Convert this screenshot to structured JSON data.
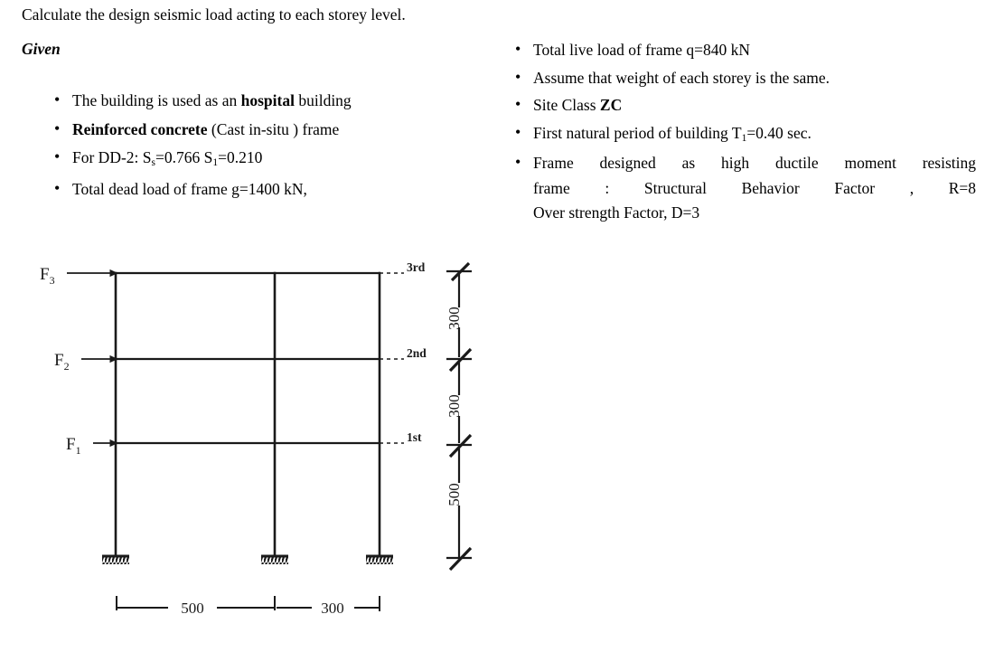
{
  "question": {
    "prompt": "Calculate the design seismic load acting to each storey level.",
    "given_heading": "Given"
  },
  "given_left": [
    {
      "segments": [
        {
          "text": "The building is used as an ",
          "bold": false
        },
        {
          "text": "hospital",
          "bold": true
        },
        {
          "text": " building",
          "bold": false
        }
      ]
    },
    {
      "segments": [
        {
          "text": "Reinforced concrete",
          "bold": true
        },
        {
          "text": " (Cast in-situ ) frame",
          "bold": false
        }
      ]
    },
    {
      "segments": [
        {
          "text": "For DD-2: S",
          "bold": false
        },
        {
          "text": "s",
          "sub": true
        },
        {
          "text": "=0.766  S",
          "bold": false
        },
        {
          "text": "1",
          "sub": true
        },
        {
          "text": "=0.210",
          "bold": false
        }
      ]
    },
    {
      "segments": [
        {
          "text": "Total dead load of frame  g=1400 kN,",
          "bold": false
        }
      ]
    }
  ],
  "given_right": [
    {
      "segments": [
        {
          "text": "Total live load of frame  q=840 kN",
          "bold": false
        }
      ]
    },
    {
      "segments": [
        {
          "text": "Assume that weight of each storey is the same.",
          "bold": false
        }
      ]
    },
    {
      "segments": [
        {
          "text": "Site Class ",
          "bold": false
        },
        {
          "text": "ZC",
          "bold": true
        }
      ]
    },
    {
      "segments": [
        {
          "text": "First natural period of building T",
          "bold": false
        },
        {
          "text": "1",
          "sub": true
        },
        {
          "text": "=0.40 sec.",
          "bold": false
        }
      ]
    },
    {
      "justified": true,
      "lines": [
        "Frame designed as high ductile moment resisting",
        "frame : Structural Behavior Factor , R=8",
        "Over strength Factor, D=3"
      ]
    }
  ],
  "diagram": {
    "force_labels": [
      {
        "name": "F3",
        "base": "F",
        "sub": "3"
      },
      {
        "name": "F2",
        "base": "F",
        "sub": "2"
      },
      {
        "name": "F1",
        "base": "F",
        "sub": "1"
      }
    ],
    "storey_labels": [
      "3rd",
      "2nd",
      "1st"
    ],
    "vertical_dimensions": [
      "300",
      "300",
      "500"
    ],
    "horizontal_dimensions": [
      "500",
      "300"
    ],
    "line_color": "#1a1a1a",
    "support_type": "fixed",
    "bays": 2,
    "storeys": 3
  }
}
